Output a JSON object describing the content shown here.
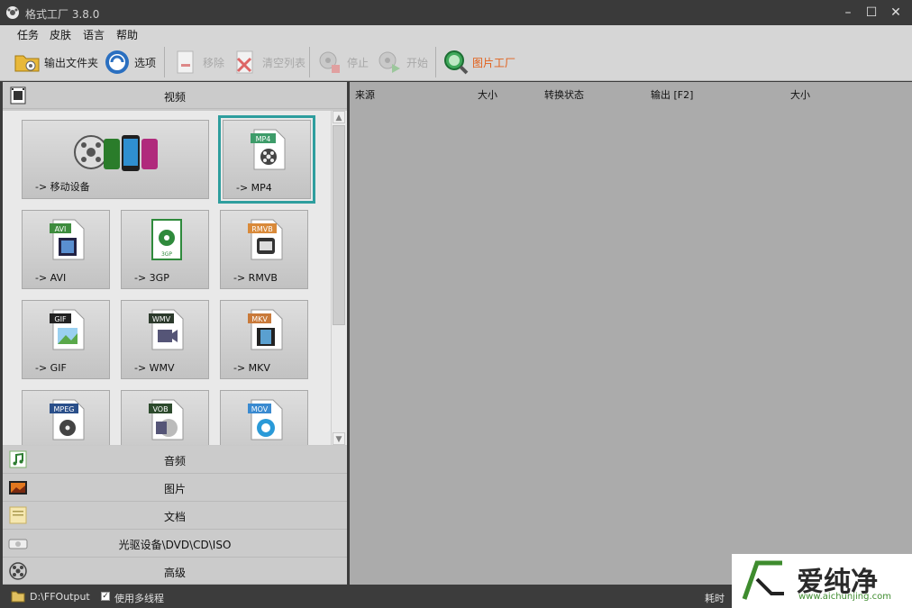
{
  "window": {
    "title": "格式工厂 3.8.0"
  },
  "menu": [
    "任务",
    "皮肤",
    "语言",
    "帮助"
  ],
  "toolbar": {
    "output_folder": "输出文件夹",
    "options": "选项",
    "remove": "移除",
    "clear_list": "清空列表",
    "stop": "停止",
    "start": "开始",
    "picture_factory": "图片工厂"
  },
  "categories": {
    "video": "视频",
    "audio": "音频",
    "picture": "图片",
    "document": "文档",
    "rom": "光驱设备\\DVD\\CD\\ISO",
    "advanced": "高级"
  },
  "tiles": [
    {
      "label": "-> 移动设备",
      "badge": ""
    },
    {
      "label": "-> MP4",
      "badge": "MP4"
    },
    {
      "label": "-> AVI",
      "badge": "AVI"
    },
    {
      "label": "-> 3GP",
      "badge": "3GP"
    },
    {
      "label": "-> RMVB",
      "badge": "RMVB"
    },
    {
      "label": "-> GIF",
      "badge": "GIF"
    },
    {
      "label": "-> WMV",
      "badge": "WMV"
    },
    {
      "label": "-> MKV",
      "badge": "MKV"
    },
    {
      "label": "",
      "badge": "MPEG"
    },
    {
      "label": "",
      "badge": "VOB"
    },
    {
      "label": "",
      "badge": "MOV"
    }
  ],
  "columns": {
    "source": "来源",
    "size": "大小",
    "status": "转换状态",
    "output": "输出 [F2]",
    "out_size": "大小"
  },
  "status": {
    "output_path": "D:\\FFOutput",
    "multithread": "使用多线程",
    "elapsed": "耗时"
  },
  "watermark": {
    "brand": "爱纯净",
    "url": "www.aichunjing.com"
  }
}
